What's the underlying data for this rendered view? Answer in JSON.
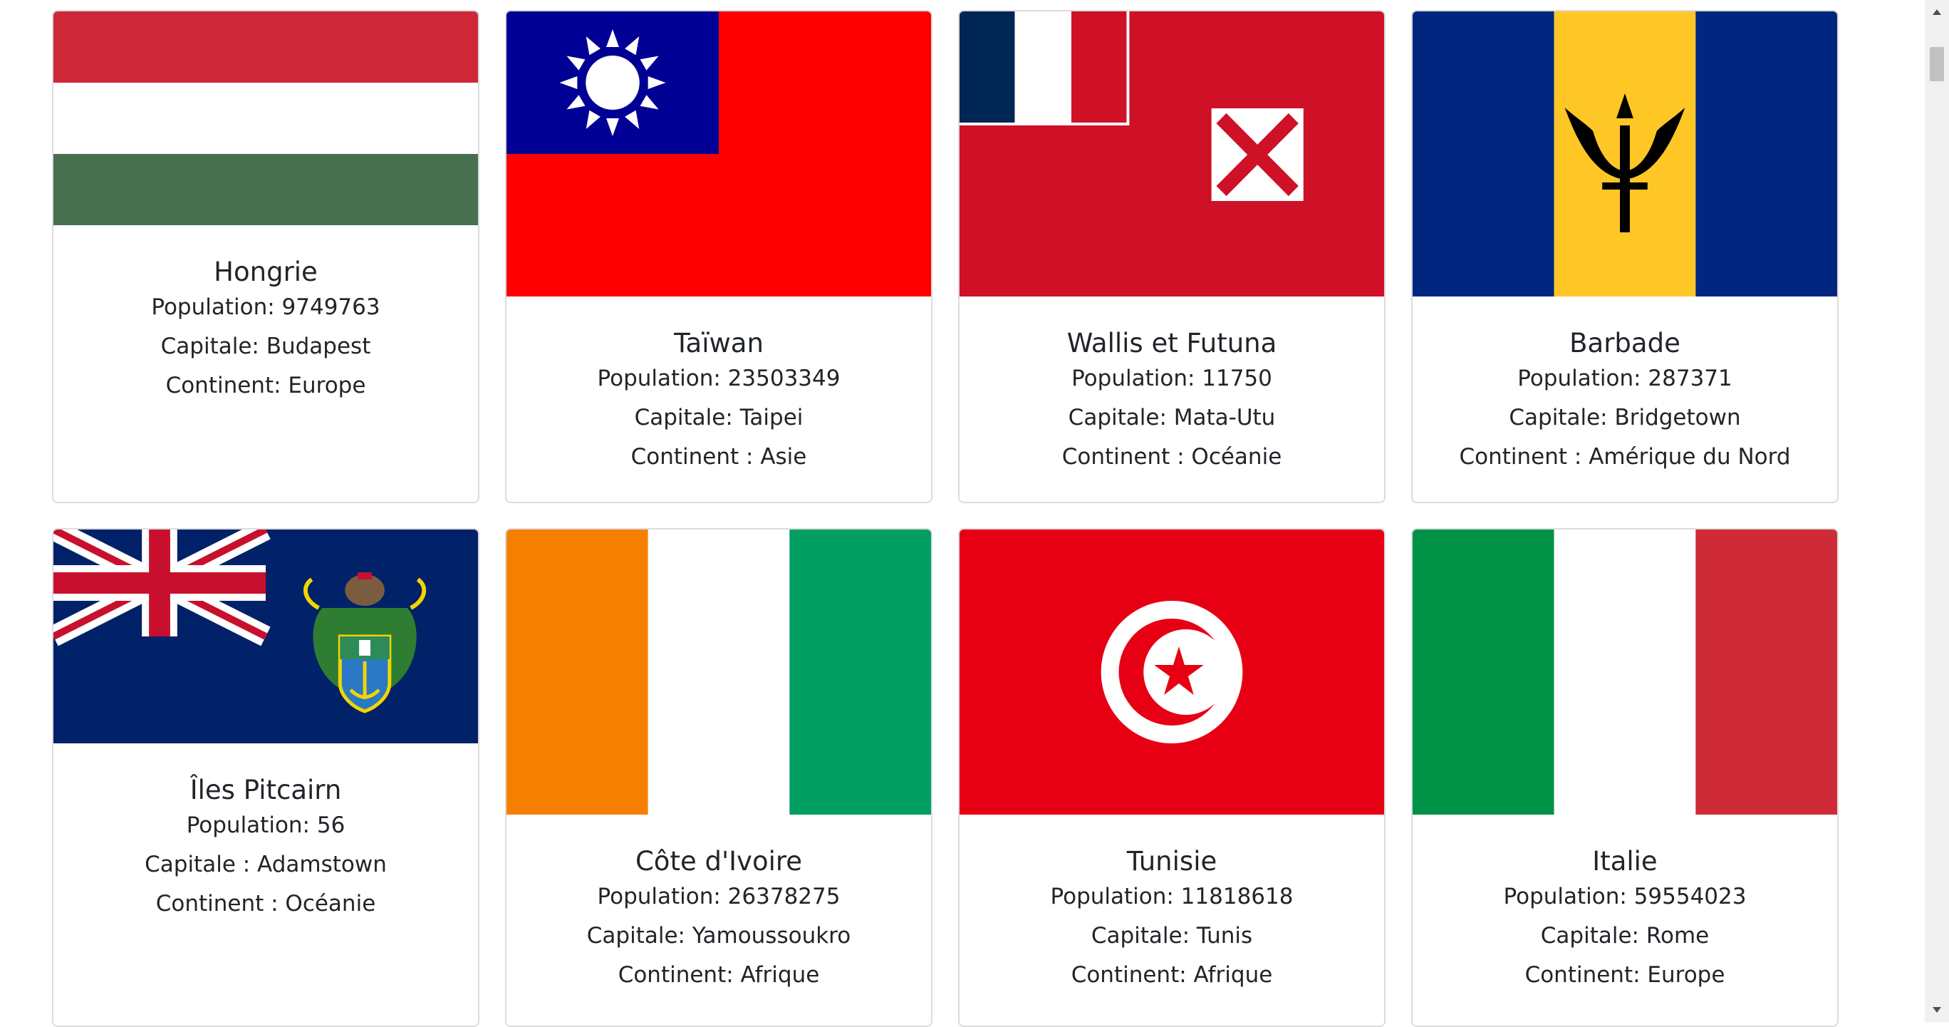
{
  "cards": [
    {
      "name": "Hongrie",
      "population": "Population: 9749763",
      "capital": "Capitale: Budapest",
      "continent": "Continent: Europe",
      "flag": "hungary-flag"
    },
    {
      "name": "Taïwan",
      "population": "Population: 23503349",
      "capital": "Capitale: Taipei",
      "continent": "Continent : Asie",
      "flag": "taiwan-flag"
    },
    {
      "name": "Wallis et Futuna",
      "population": "Population: 11750",
      "capital": "Capitale: Mata-Utu",
      "continent": "Continent : Océanie",
      "flag": "wallis-futuna-flag"
    },
    {
      "name": "Barbade",
      "population": "Population: 287371",
      "capital": "Capitale: Bridgetown",
      "continent": "Continent : Amérique du Nord",
      "flag": "barbados-flag"
    },
    {
      "name": "Îles Pitcairn",
      "population": "Population: 56",
      "capital": "Capitale : Adamstown",
      "continent": "Continent : Océanie",
      "flag": "pitcairn-flag"
    },
    {
      "name": "Côte d'Ivoire",
      "population": "Population: 26378275",
      "capital": "Capitale: Yamoussoukro",
      "continent": "Continent: Afrique",
      "flag": "ivory-coast-flag"
    },
    {
      "name": "Tunisie",
      "population": "Population: 11818618",
      "capital": "Capitale: Tunis",
      "continent": "Continent: Afrique",
      "flag": "tunisia-flag"
    },
    {
      "name": "Italie",
      "population": "Population: 59554023",
      "capital": "Capitale: Rome",
      "continent": "Continent: Europe",
      "flag": "italy-flag"
    }
  ],
  "colors": {
    "card_border": "#dcdcdc",
    "text": "#212529",
    "scrollbar_track": "#f1f1f1",
    "scrollbar_thumb": "#c1c1c1"
  }
}
